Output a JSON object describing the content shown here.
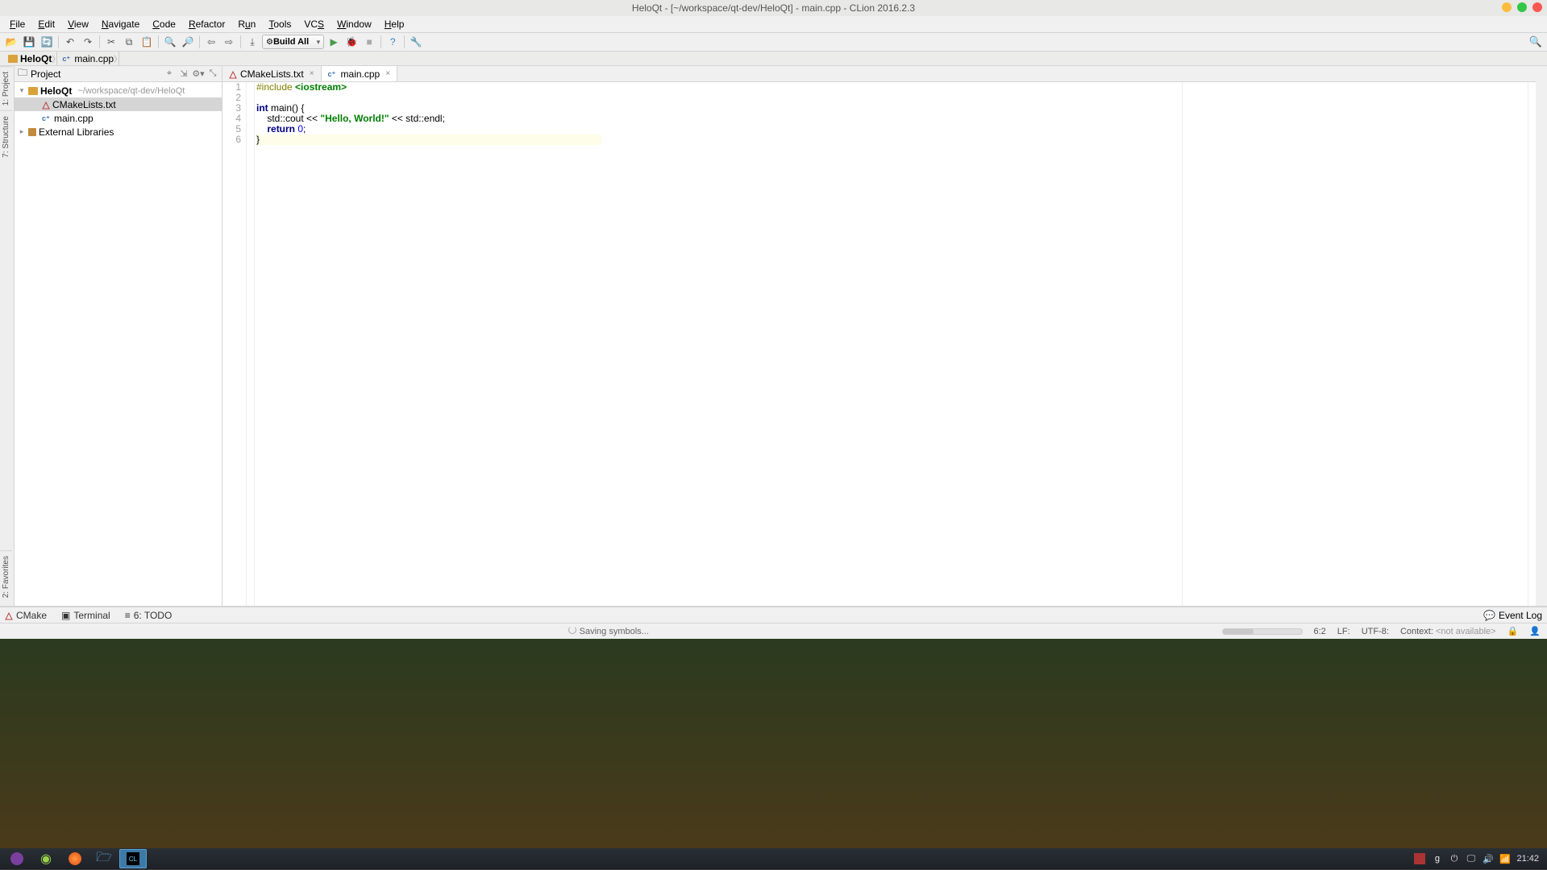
{
  "title": "HeloQt - [~/workspace/qt-dev/HeloQt] - main.cpp - CLion 2016.2.3",
  "menu": {
    "items": [
      "File",
      "Edit",
      "View",
      "Navigate",
      "Code",
      "Refactor",
      "Run",
      "Tools",
      "VCS",
      "Window",
      "Help"
    ]
  },
  "toolbar": {
    "build_label": "Build All"
  },
  "breadcrumb": {
    "0": "HeloQt",
    "1": "main.cpp"
  },
  "project_panel": {
    "title": "Project",
    "root": {
      "name": "HeloQt",
      "path": "~/workspace/qt-dev/HeloQt"
    },
    "files": {
      "0": "CMakeLists.txt",
      "1": "main.cpp"
    },
    "ext_lib": "External Libraries"
  },
  "left_tabs": {
    "0": "1: Project",
    "1": "7: Structure"
  },
  "left_tabs_bottom": {
    "0": "2: Favorites"
  },
  "tabs": {
    "0": "CMakeLists.txt",
    "1": "main.cpp"
  },
  "code": {
    "l1": {
      "pp": "#include",
      "inc": "<iostream>"
    },
    "l3": {
      "a": "int",
      "b": " main() ",
      "c": "{"
    },
    "l4": {
      "a": "    std::cout << ",
      "b": "\"Hello, World!\"",
      "c": " << std::endl;"
    },
    "l5": {
      "a": "    ",
      "b": "return",
      "c": " ",
      "d": "0",
      "e": ";"
    },
    "l6": "}"
  },
  "line_numbers": {
    "1": "1",
    "2": "2",
    "3": "3",
    "4": "4",
    "5": "5",
    "6": "6"
  },
  "toolwin": {
    "cmake": "CMake",
    "terminal": "Terminal",
    "todo": "6: TODO",
    "eventlog": "Event Log"
  },
  "status": {
    "msg": "Saving symbols...",
    "pos": "6:2",
    "le": "LF:",
    "enc": "UTF-8:",
    "ctx_label": "Context:",
    "ctx_val": "<not available>"
  },
  "tray": {
    "time": "21:42"
  }
}
